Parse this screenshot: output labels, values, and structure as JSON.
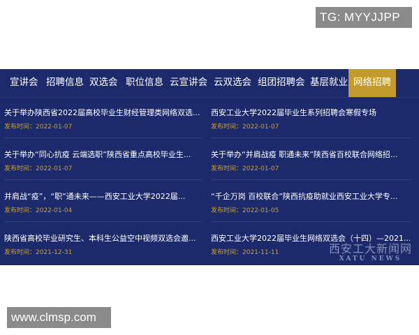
{
  "overlay": {
    "tg_label": "TG: MYYJJPP",
    "site_label": "www.clmsp.com"
  },
  "nav": {
    "items": [
      {
        "label": "宣讲会"
      },
      {
        "label": "招聘信息"
      },
      {
        "label": "双选会"
      },
      {
        "label": "职位信息"
      },
      {
        "label": "云宣讲会"
      },
      {
        "label": "云双选会"
      },
      {
        "label": "组团招聘会"
      },
      {
        "label": "基层就业"
      },
      {
        "label": "网络招聘"
      }
    ],
    "active_index": 8
  },
  "news": [
    {
      "title": "关于举办陕西省2022届高校毕业生财经管理类网络双选...",
      "date": "发布时间：2022-01-07"
    },
    {
      "title": "西安工业大学2022届毕业生系列招聘会寒假专场",
      "date": "发布时间：2022-01-07"
    },
    {
      "title": "关于举办“同心抗疫 云端选职”陕西省重点高校毕业生...",
      "date": "发布时间：2022-01-07"
    },
    {
      "title": "关于举办“并肩战疫 职通未来”陕西省百校联合网络招...",
      "date": "发布时间：2022-01-07"
    },
    {
      "title": "并肩战“疫”，“职”通未来——西安工业大学2022届...",
      "date": "发布时间：2022-01-04"
    },
    {
      "title": "“千企万岗 百校联合”陕西抗疫助就业西安工业大学专...",
      "date": "发布时间：2022-01-05"
    },
    {
      "title": "陕西省高校毕业研究生、本科生公益空中视频双选会邀...",
      "date": "发布时间：2021-12-31"
    },
    {
      "title": "西安工业大学2022届毕业生网络双选会（十四）—2021...",
      "date": "发布时间：2021-11-11"
    }
  ],
  "watermark": {
    "cn": "西安工大新闻网",
    "en": "XATU NEWS"
  },
  "colors": {
    "panel_bg": "#1c2a6b",
    "active_tab": "#c39a2c",
    "date_text": "#c8a13a",
    "badge_bg": "#8a8a8a"
  }
}
